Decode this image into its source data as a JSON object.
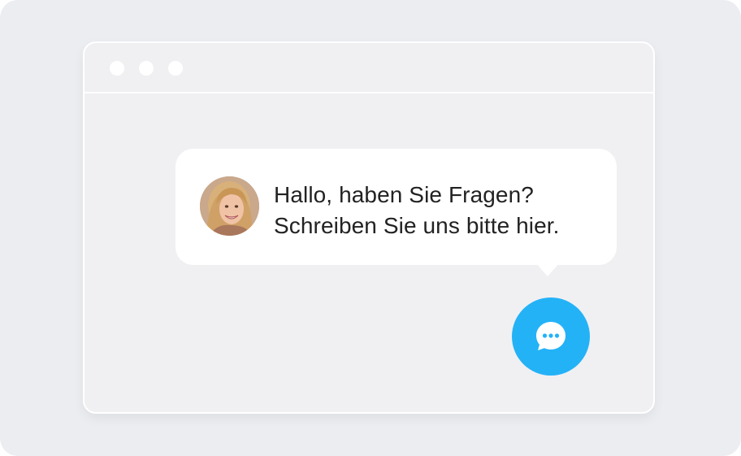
{
  "chat_widget": {
    "message_line_1": "Hallo, haben Sie Fragen?",
    "message_line_2": "Schreiben Sie uns bitte hier.",
    "avatar_icon": "agent-avatar-photo",
    "launcher_icon": "chat-bubble-icon",
    "accent_color": "#24B2F7"
  },
  "browser": {
    "window_controls": [
      "window-dot",
      "window-dot",
      "window-dot"
    ],
    "background_color": "#F0F0F3"
  }
}
